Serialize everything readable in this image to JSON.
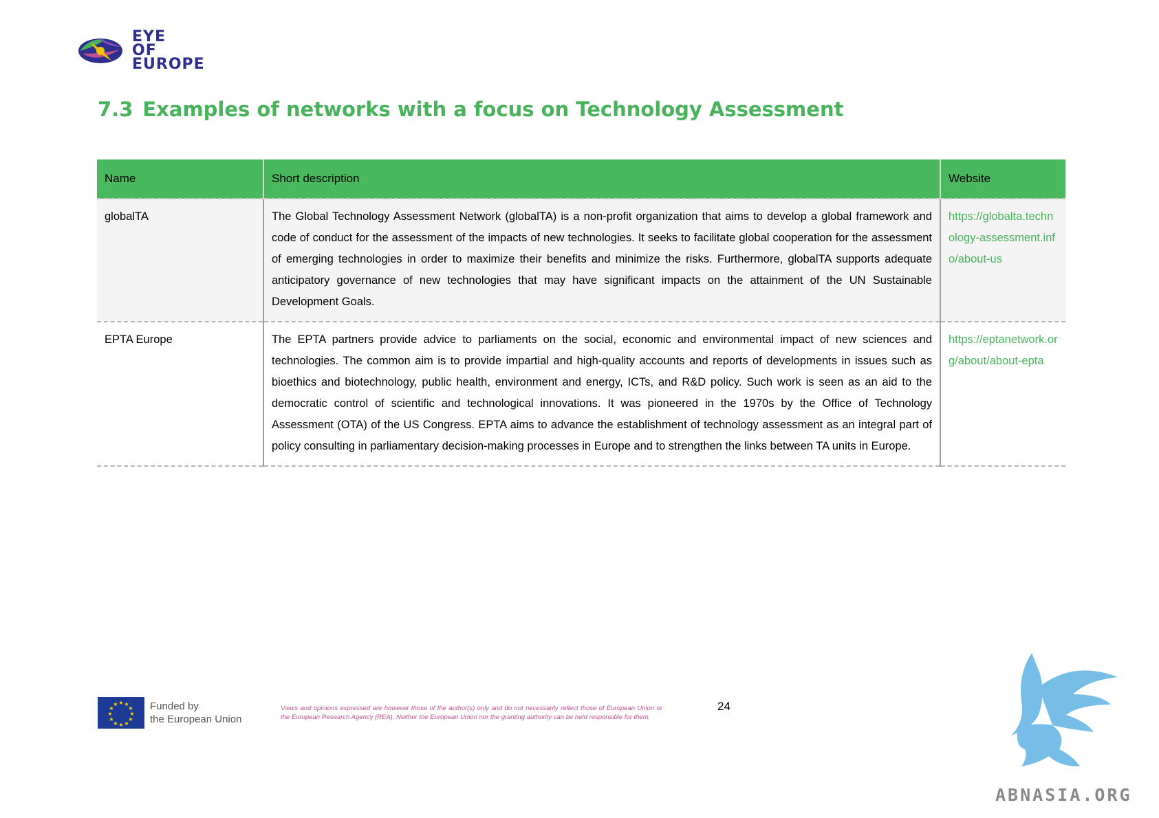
{
  "logo": {
    "line1": "EYE",
    "line2": "OF",
    "line3": "EUROPE"
  },
  "heading": {
    "number": "7.3",
    "text": "Examples of networks with a focus on Technology Assessment"
  },
  "table": {
    "headers": [
      "Name",
      "Short description",
      "Website"
    ],
    "rows": [
      {
        "name": "globalTA",
        "description": "The Global Technology Assessment Network (globalTA) is a non-profit organization that aims to develop a global framework and code of conduct for the assessment of the impacts of new technologies. It seeks to facilitate global cooperation for the assessment of emerging technologies in order to maximize their benefits and minimize the risks. Furthermore, globalTA supports adequate anticipatory governance of new technologies that may have significant impacts on the attainment of the UN Sustainable Development Goals.",
        "website": "https://globalta.technology-assessment.info/about-us"
      },
      {
        "name": "EPTA Europe",
        "description": "The EPTA partners provide advice to parliaments on the social, economic and environmental impact of new sciences and technologies. The common aim is to provide impartial and high-quality accounts and reports of developments in issues such as bioethics and biotechnology, public health, environment and energy, ICTs, and R&D policy. Such work is seen as an aid to the democratic control of scientific and technological innovations. It was pioneered in the 1970s by the Office of Technology Assessment (OTA) of the US Congress. EPTA aims to advance the establishment of technology assessment as an integral part of policy consulting in parliamentary decision-making processes in Europe and to strengthen the links between TA units in Europe.",
        "website": "https://eptanetwork.org/about/about-epta"
      }
    ]
  },
  "footer": {
    "eu_line1": "Funded by",
    "eu_line2": "the European Union",
    "disclaimer": "Views and opinions expressed are however those of the author(s) only and do not necessarily reflect those of European Union or the European Research Agency (REA). Neither the European Union nor the granting authority can be held responsible for them.",
    "page_number": "24"
  },
  "watermark": {
    "text": "ABNASIA.ORG"
  },
  "colors": {
    "accent_green": "#49b35c",
    "header_green": "#49b85f",
    "logo_blue": "#2f2f8f",
    "eu_blue": "#1d3a95",
    "disclaimer_pink": "#c0508e",
    "watermark_blue": "#5fb3e3"
  }
}
